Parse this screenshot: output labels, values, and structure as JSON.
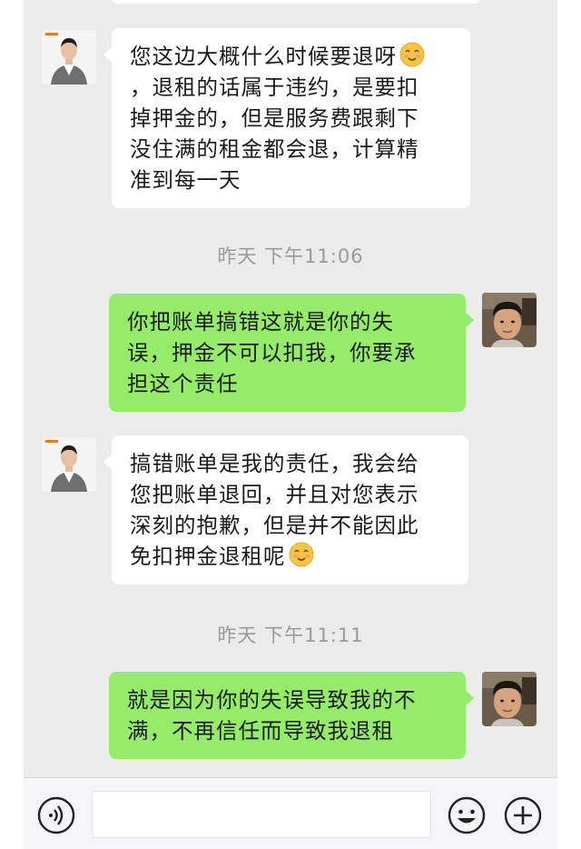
{
  "messages": [
    {
      "side": "in",
      "lines": [
        "您这边大概什么时候要退呀",
        "，退租的话属于违约，是要扣",
        "掉押金的，但是服务费跟剩下",
        "没住满的租金都会退，计算精",
        "准到每一天"
      ],
      "emoji_after_line": 0,
      "emoji_icon": "smiling-face-emoji-icon"
    },
    {
      "side": "time",
      "text": "昨天 下午11:06"
    },
    {
      "side": "out",
      "lines": [
        "你把账单搞错这就是你的失",
        "误，押金不可以扣我，你要承",
        "担这个责任"
      ]
    },
    {
      "side": "in",
      "lines": [
        "搞错账单是我的责任，我会给",
        "您把账单退回，并且对您表示",
        "深刻的抱歉，但是并不能因此",
        "免扣押金退租呢"
      ],
      "emoji_after_line": 3,
      "emoji_icon": "smiling-face-emoji-icon"
    },
    {
      "side": "time",
      "text": "昨天 下午11:11"
    },
    {
      "side": "out",
      "lines": [
        "就是因为你的失误导致我的不",
        "满，不再信任而导致我退租"
      ]
    }
  ],
  "input_bar": {
    "voice_icon": "voice-mode-icon",
    "emoji_icon": "emoji-face-icon",
    "more_icon": "plus-circle-icon",
    "input_value": ""
  },
  "colors": {
    "chat_background": "#ebebeb",
    "incoming_bubble": "#ffffff",
    "outgoing_bubble": "#95ec69",
    "timestamp_text": "#9a9a9a"
  }
}
